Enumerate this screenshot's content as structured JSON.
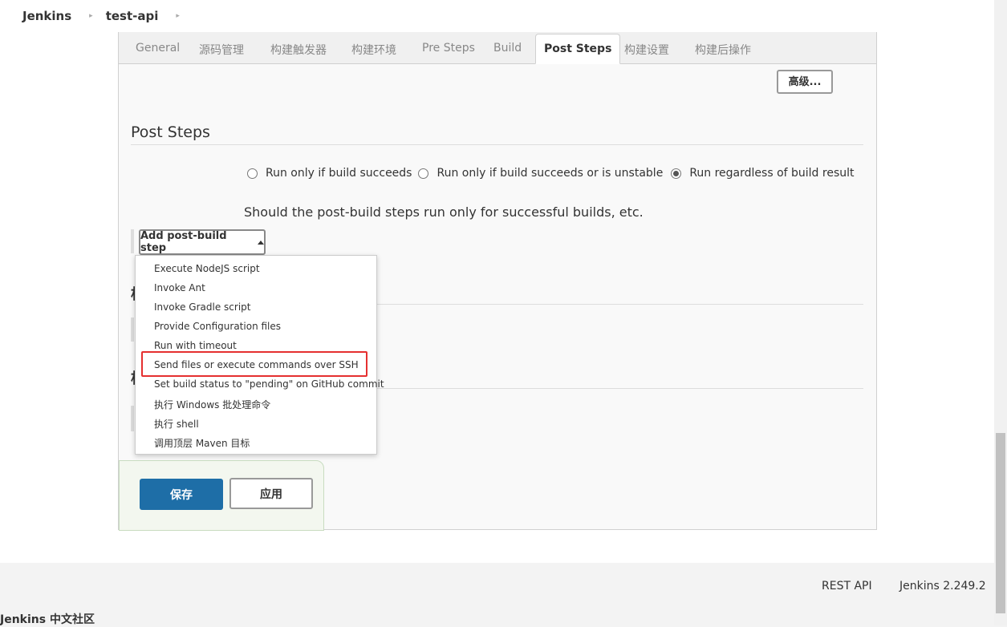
{
  "breadcrumb": {
    "items": [
      "Jenkins",
      "test-api"
    ],
    "separator": "▸"
  },
  "tabs": [
    {
      "label": "General",
      "active": false
    },
    {
      "label": "源码管理",
      "active": false
    },
    {
      "label": "构建触发器",
      "active": false
    },
    {
      "label": "构建环境",
      "active": false
    },
    {
      "label": "Pre Steps",
      "active": false
    },
    {
      "label": "Build",
      "active": false
    },
    {
      "label": "Post Steps",
      "active": true
    },
    {
      "label": "构建设置",
      "active": false
    },
    {
      "label": "构建后操作",
      "active": false
    }
  ],
  "advanced_button": "高级...",
  "post_steps": {
    "title": "Post Steps",
    "options": [
      {
        "label": "Run only if build succeeds",
        "checked": false
      },
      {
        "label": "Run only if build succeeds or is unstable",
        "checked": false
      },
      {
        "label": "Run regardless of build result",
        "checked": true
      }
    ],
    "help": "Should the post-build steps run only for successful builds, etc.",
    "add_step_label": "Add post-build step"
  },
  "hidden_sections": {
    "char1": "构",
    "char2": "构"
  },
  "dropdown": {
    "items": [
      "Execute NodeJS script",
      "Invoke Ant",
      "Invoke Gradle script",
      "Provide Configuration files",
      "Run with timeout",
      "Send files or execute commands over SSH",
      "Set build status to \"pending\" on GitHub commit",
      "执行 Windows 批处理命令",
      "执行 shell",
      "调用顶层 Maven 目标"
    ],
    "highlighted_index": 5,
    "highlight_color": "#e53030"
  },
  "actions": {
    "save": "保存",
    "apply": "应用",
    "save_color": "#1e6ea7"
  },
  "footer": {
    "rest_api": "REST API",
    "version": "Jenkins 2.249.2",
    "community": "Jenkins 中文社区"
  }
}
